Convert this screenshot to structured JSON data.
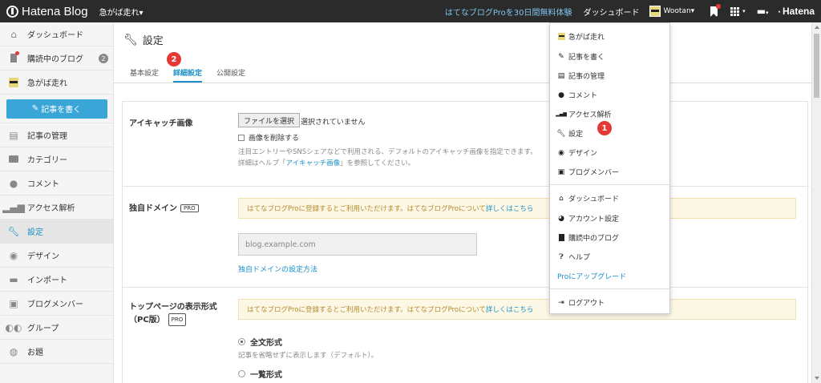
{
  "topbar": {
    "logo": "Hatena Blog",
    "blog_name": "急がば走れ▾",
    "pro_trial": "はてなブログProを30日間無料体験",
    "dashboard": "ダッシュボード",
    "user": "Wootan▾",
    "hatena": "Hatena"
  },
  "sidebar": {
    "dashboard": "ダッシュボード",
    "subscribed": "購読中のブログ",
    "subscribed_count": "2",
    "blog": "急がば走れ",
    "write": "記事を書く",
    "manage": "記事の管理",
    "category": "カテゴリー",
    "comment": "コメント",
    "access": "アクセス解析",
    "settings": "設定",
    "design": "デザイン",
    "import": "インポート",
    "members": "ブログメンバー",
    "group": "グループ",
    "topic": "お題"
  },
  "main": {
    "title": "設定",
    "tabs": [
      "基本設定",
      "詳細設定",
      "公開設定"
    ]
  },
  "eyecatch": {
    "label": "アイキャッチ画像",
    "file_button": "ファイルを選択",
    "file_status": "選択されていません",
    "delete_label": "画像を削除する",
    "help1": "注目エントリーやSNSシェアなどで利用される、デフォルトのアイキャッチ画像を指定できます。",
    "help2_pre": "詳細はヘルプ「",
    "help2_link": "アイキャッチ画像",
    "help2_post": "」を参照してください。"
  },
  "domain": {
    "label": "独自ドメイン",
    "pro": "PRO",
    "notice": "はてなブログProに登録するとご利用いただけます。はてなブログProについて",
    "notice_link": "詳しくはこちら",
    "placeholder": "blog.example.com",
    "setup_link": "独自ドメインの設定方法"
  },
  "toppage": {
    "label1": "トップページの表示形式",
    "label2": "（PC版）",
    "pro": "PRO",
    "notice": "はてなブログProに登録するとご利用いただけます。はてなブログProについて",
    "notice_link": "詳しくはこちら",
    "full": "全文形式",
    "full_desc": "記事を省略せずに表示します（デフォルト）。",
    "list": "一覧形式"
  },
  "dropdown": {
    "blog": "急がば走れ",
    "write": "記事を書く",
    "manage": "記事の管理",
    "comment": "コメント",
    "access": "アクセス解析",
    "settings": "設定",
    "design": "デザイン",
    "members": "ブログメンバー",
    "dashboard": "ダッシュボード",
    "account": "アカウント設定",
    "subscribed": "購読中のブログ",
    "help": "ヘルプ",
    "upgrade": "Proにアップグレード",
    "logout": "ログアウト"
  },
  "markers": {
    "one": "1",
    "two": "2"
  },
  "colors": {
    "accent": "#1a8fc8",
    "write_button": "#3aa6d8",
    "marker": "#e53935",
    "notice_bg": "#fdf8e6"
  }
}
